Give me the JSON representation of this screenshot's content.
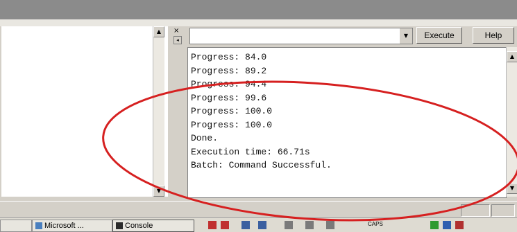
{
  "toolbar": {
    "execute_label": "Execute",
    "help_label": "Help",
    "command_value": ""
  },
  "splitter": {
    "close_glyph": "×",
    "pin_glyph": "◂"
  },
  "scroll": {
    "up_glyph": "▲",
    "down_glyph": "▼"
  },
  "output": {
    "lines": [
      "Progress: 84.0",
      "Progress: 89.2",
      "Progress: 94.4",
      "Progress: 99.6",
      "Progress: 100.0",
      "Progress: 100.0",
      "Done.",
      "Execution time: 66.71s",
      "Batch: Command Successful."
    ]
  },
  "taskbar": {
    "items": [
      {
        "label": "Microsoft ...",
        "icon": "app-icon"
      },
      {
        "label": "Console",
        "icon": "console-icon"
      }
    ],
    "caps_label": "CAPS"
  },
  "annotation": {
    "color": "#d62020"
  },
  "icons": {
    "execute": "none",
    "combo_arrow": "chevron-down-icon",
    "close": "close-icon",
    "pin": "pin-icon"
  }
}
